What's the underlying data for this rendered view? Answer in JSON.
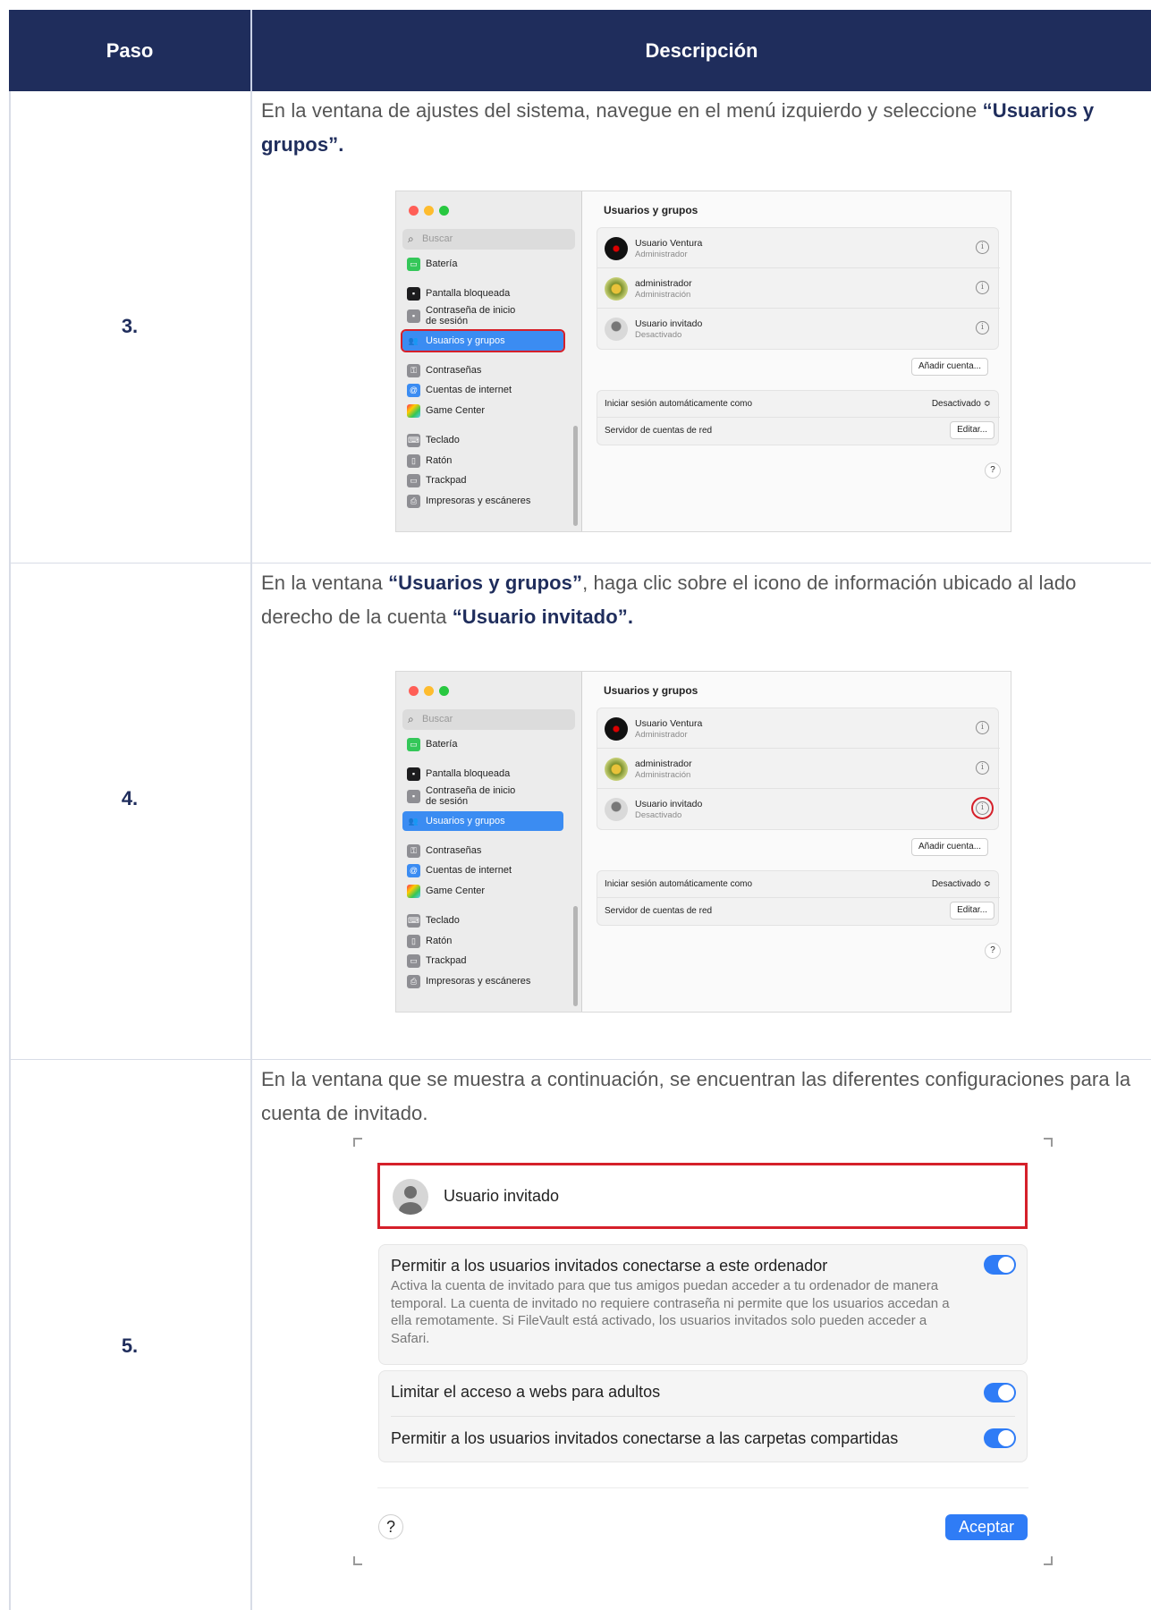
{
  "table": {
    "headers": {
      "step": "Paso",
      "description": "Descripción"
    },
    "rows": [
      {
        "step": "3.",
        "text_before": "En la ventana de ajustes del sistema, navegue en el menú izquierdo y seleccione ",
        "text_bold": "“Usuarios y grupos”.",
        "screenshot": "settings-sidebar"
      },
      {
        "step": "4.",
        "text_1": "En la ventana ",
        "bold_1": "“Usuarios y grupos”",
        "text_2": ", haga clic sobre el icono de información   ubicado al lado derecho de la cuenta ",
        "bold_2": "“Usuario invitado”.",
        "screenshot": "settings-info"
      },
      {
        "step": "5.",
        "text": "En la ventana que se muestra a continuación, se encuentran las diferentes configuraciones para la cuenta de invitado.",
        "screenshot": "guest-dialog"
      }
    ]
  },
  "mac_window": {
    "search_placeholder": "Buscar",
    "sidebar_items": [
      {
        "label": "Batería",
        "icon": "battery-icon",
        "color": "#34c759"
      },
      {
        "label": "Pantalla bloqueada",
        "icon": "lock-screen-icon",
        "color": "#1c1c1e"
      },
      {
        "label": "Contraseña de inicio",
        "label2": "de sesión",
        "icon": "lock-icon",
        "color": "#8e8e93"
      },
      {
        "label": "Usuarios y grupos",
        "icon": "users-icon",
        "color": "#3b8cf2"
      },
      {
        "label": "Contraseñas",
        "icon": "key-icon",
        "color": "#8e8e93"
      },
      {
        "label": "Cuentas de internet",
        "icon": "at-icon",
        "color": "#3b8cf2"
      },
      {
        "label": "Game Center",
        "icon": "game-center-icon",
        "color": "#ff9f0a"
      },
      {
        "label": "Teclado",
        "icon": "keyboard-icon",
        "color": "#8e8e93"
      },
      {
        "label": "Ratón",
        "icon": "mouse-icon",
        "color": "#8e8e93"
      },
      {
        "label": "Trackpad",
        "icon": "trackpad-icon",
        "color": "#8e8e93"
      },
      {
        "label": "Impresoras y escáneres",
        "icon": "printer-icon",
        "color": "#8e8e93"
      }
    ],
    "title": "Usuarios y grupos",
    "users": [
      {
        "name": "Usuario Ventura",
        "role": "Administrador"
      },
      {
        "name": "administrador",
        "role": "Administración"
      },
      {
        "name": "Usuario invitado",
        "role": "Desactivado"
      }
    ],
    "add_account": "Añadir cuenta...",
    "auto_login_label": "Iniciar sesión automáticamente como",
    "auto_login_value": "Desactivado ≎",
    "network_server_label": "Servidor de cuentas de red",
    "edit_button": "Editar...",
    "help": "?"
  },
  "guest_dialog": {
    "user_name": "Usuario invitado",
    "allow_guests_title": "Permitir a los usuarios invitados conectarse a este ordenador",
    "allow_guests_desc": "Activa la cuenta de invitado para que tus amigos puedan acceder a tu ordenador de manera temporal. La cuenta de invitado no requiere contraseña ni permite que los usuarios accedan a ella remotamente. Si FileVault está activado, los usuarios invitados solo pueden acceder a Safari.",
    "limit_adult": "Limitar el acceso a webs para adultos",
    "allow_shared": "Permitir a los usuarios invitados conectarse a las carpetas compartidas",
    "help": "?",
    "accept": "Aceptar",
    "toggles": {
      "allow_guests": true,
      "limit_adult": true,
      "allow_shared": true
    }
  },
  "colors": {
    "header_bg": "#1f2d5c",
    "highlight": "#d5202a",
    "accent": "#2f7cf6"
  }
}
